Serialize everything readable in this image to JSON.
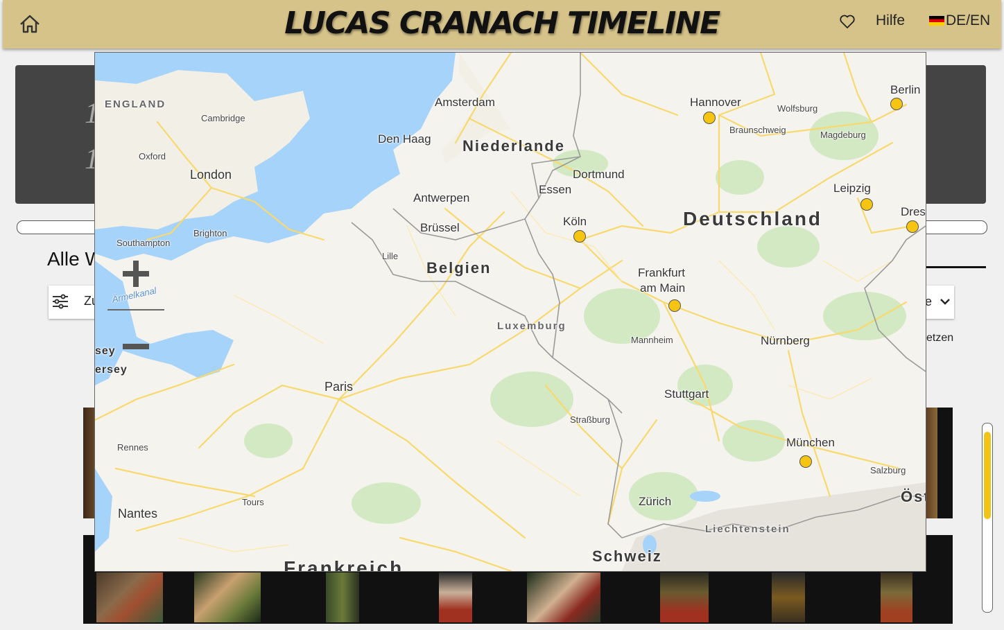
{
  "header": {
    "title": "LUCAS CRANACH TIMELINE",
    "help_label": "Hilfe",
    "lang_de": "DE",
    "lang_sep": "/",
    "lang_en": "EN",
    "background_color": "#d6c38a",
    "icons": {
      "home": "home-icon",
      "favorites": "heart-icon",
      "flag": "german-flag-icon"
    }
  },
  "background": {
    "heading_fragment": "Alle W",
    "filter_fragment": "Zu",
    "sort_fragment": "le",
    "reset_fragment": "etzen",
    "ghost_chars": [
      "1",
      "1"
    ]
  },
  "map": {
    "marker_color": "#f6c512",
    "zoom_in_label": "+",
    "zoom_out_label": "−",
    "water_label": "Ärmelkanal",
    "countries": [
      {
        "label": "Niederlande",
        "kind": "country"
      },
      {
        "label": "Belgien",
        "kind": "country"
      },
      {
        "label": "Deutschland",
        "kind": "country-big"
      },
      {
        "label": "Luxemburg",
        "kind": "region"
      },
      {
        "label": "Schweiz",
        "kind": "country"
      },
      {
        "label": "Frankreich",
        "kind": "country-big"
      },
      {
        "label": "ENGLAND",
        "kind": "region"
      },
      {
        "label": "Liechtenstein",
        "kind": "region"
      },
      {
        "label": "Öst",
        "kind": "country"
      }
    ],
    "cities": [
      "Amsterdam",
      "Den Haag",
      "Hannover",
      "Wolfsburg",
      "Braunschweig",
      "Magdeburg",
      "Berlin",
      "Cambridge",
      "Oxford",
      "London",
      "Dortmund",
      "Essen",
      "Antwerpen",
      "Brüssel",
      "Lille",
      "Köln",
      "Leipzig",
      "Dres",
      "Brighton",
      "Southampton",
      "Frankfurt",
      "am Main",
      "Mannheim",
      "Nürnberg",
      "sey",
      "ersey",
      "Paris",
      "Stuttgart",
      "Straßburg",
      "München",
      "Salzburg",
      "Rennes",
      "Tours",
      "Nantes",
      "Zürich"
    ],
    "markers": [
      "Hannover",
      "Berlin",
      "Leipzig",
      "Dresden",
      "Köln",
      "Frankfurt am Main",
      "München"
    ]
  }
}
